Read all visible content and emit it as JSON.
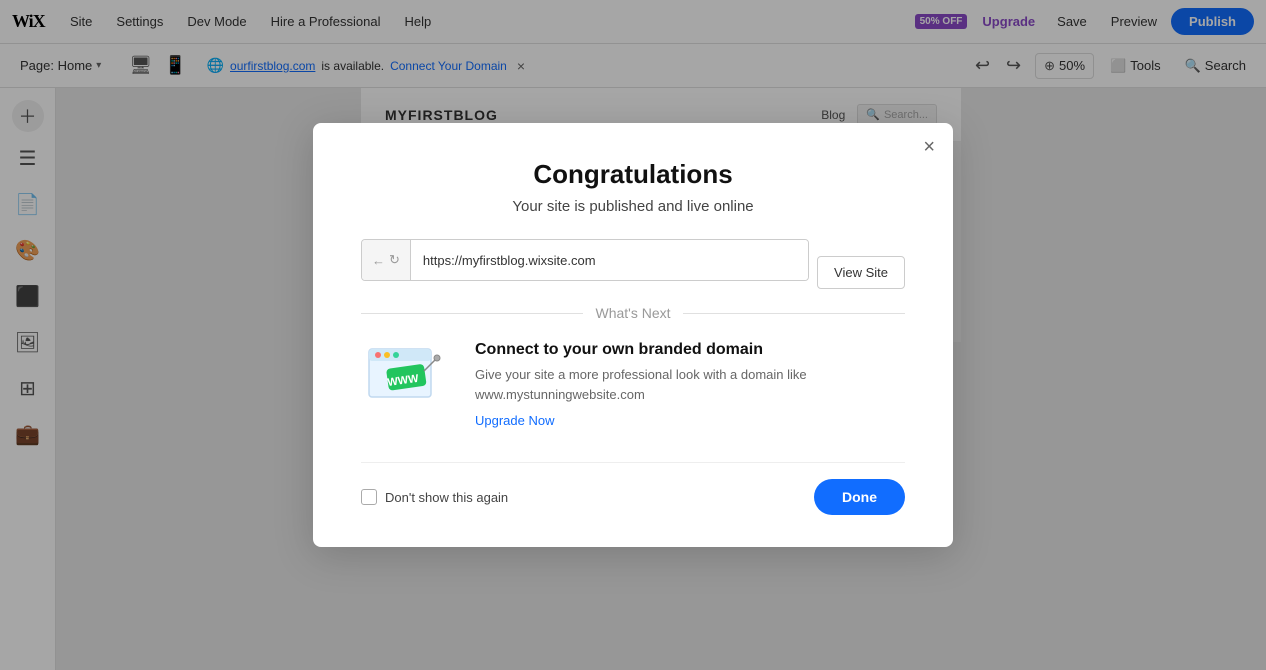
{
  "topnav": {
    "logo": "WiX",
    "items": [
      "Site",
      "Settings",
      "Dev Mode",
      "Hire a Professional",
      "Help"
    ],
    "upgrade_badge": "50% OFF",
    "upgrade_label": "Upgrade",
    "save_label": "Save",
    "preview_label": "Preview",
    "publish_label": "Publish"
  },
  "secondnav": {
    "page_label": "Page: Home",
    "domain_text": "is available.",
    "domain_link": "ourfirstblog.com",
    "connect_domain": "Connect Your Domain",
    "zoom_level": "50%",
    "tools_label": "Tools",
    "search_label": "Search"
  },
  "sidebar": {
    "icons": [
      "add",
      "pages",
      "text",
      "design",
      "app",
      "media",
      "widgets",
      "portfolio"
    ]
  },
  "canvas": {
    "blog_title": "MYFIRSTBLOG",
    "blog_nav": "Blog",
    "search_placeholder": "Search..."
  },
  "modal": {
    "close_icon": "×",
    "title": "Congratulations",
    "subtitle": "Your site is published and live online",
    "url_back": "←",
    "url_forward": "↻",
    "url_value": "https://myfirstblog.wixsite.com",
    "view_site_label": "View Site",
    "whats_next": "What's Next",
    "connect_title": "Connect to your own branded domain",
    "connect_desc": "Give your site a more professional look with a domain like www.mystunningwebsite.com",
    "connect_link": "Upgrade Now",
    "dont_show": "Don't show this again",
    "done_label": "Done"
  }
}
